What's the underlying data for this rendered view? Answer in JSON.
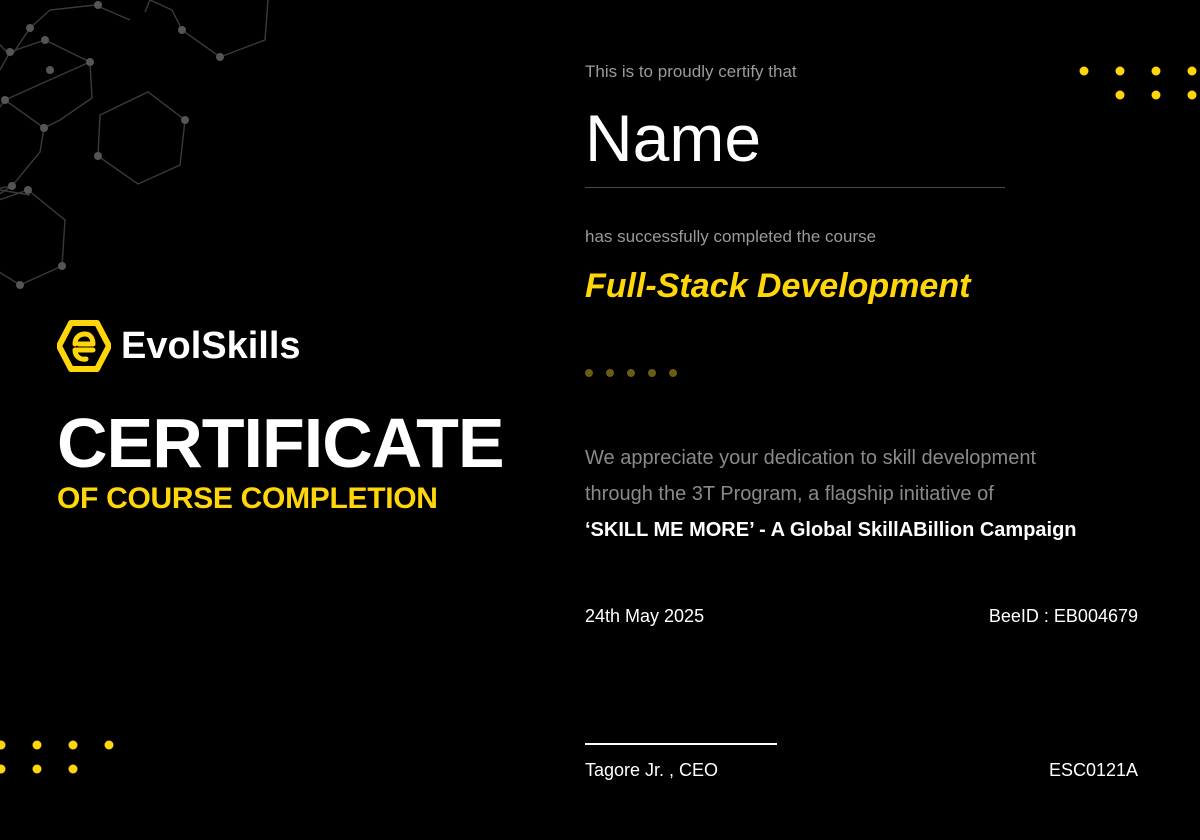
{
  "brand": {
    "name": "EvolSkills",
    "logo_icon": "hexagon-e-icon",
    "accent_color": "#ffd60a"
  },
  "certificate": {
    "title": "CERTIFICATE",
    "subtitle": "OF COURSE COMPLETION",
    "certify_text": "This is to proudly certify that",
    "recipient_name": "Name",
    "completed_text": "has successfully completed the course",
    "course_name": "Full-Stack Development",
    "appreciation_line1": "We appreciate your dedication to skill development",
    "appreciation_line2": "through the 3T Program, a flagship initiative of",
    "appreciation_line3": "‘SKILL ME MORE’ - A Global SkillABillion Campaign",
    "date": "24th May 2025",
    "bee_id": "BeeID : EB004679",
    "signatory": "Tagore Jr. , CEO",
    "certificate_code": "ESC0121A"
  }
}
